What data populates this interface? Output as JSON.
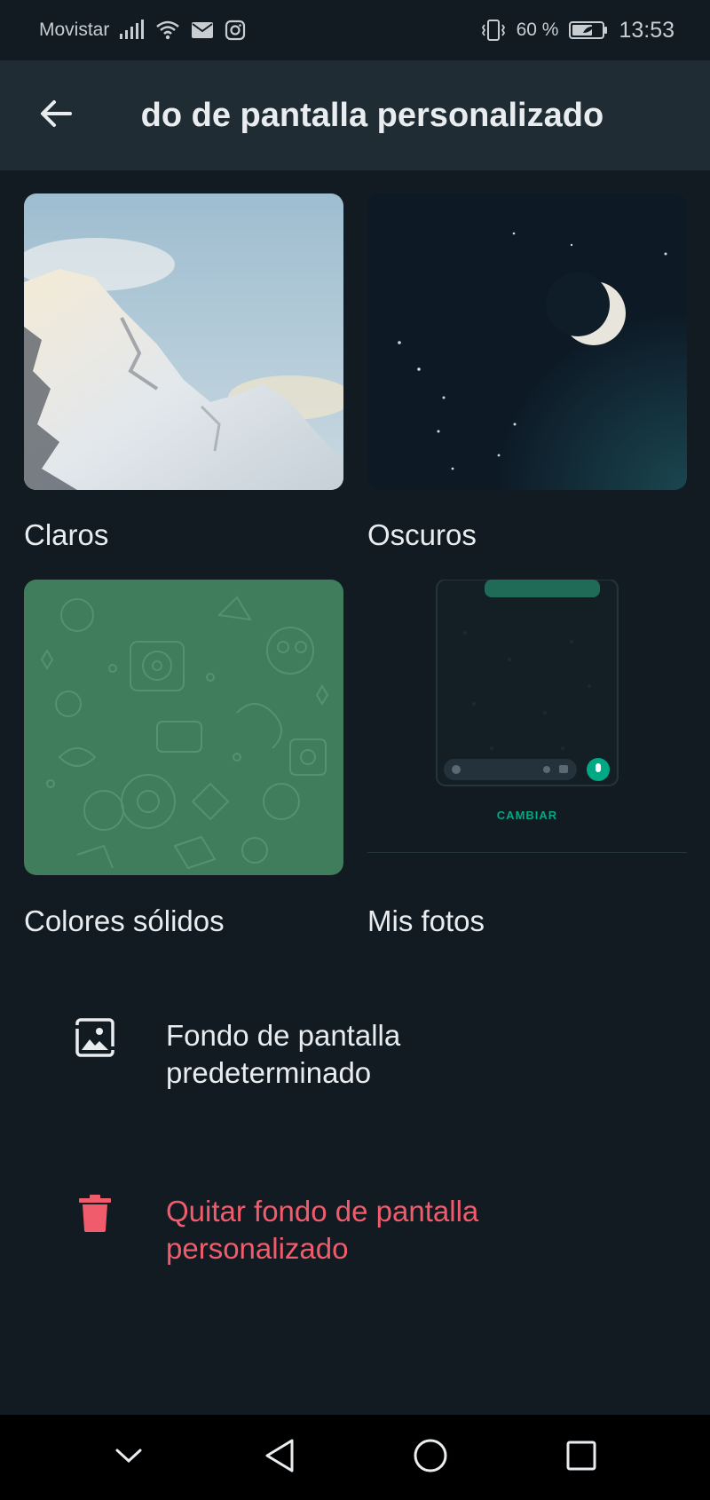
{
  "status_bar": {
    "carrier": "Movistar",
    "battery": "60 %",
    "time": "13:53"
  },
  "app_bar": {
    "title": "Fondo de pantalla personalizado",
    "back_icon": "arrow-left-icon"
  },
  "categories": [
    {
      "label": "Claros",
      "kind": "light"
    },
    {
      "label": "Oscuros",
      "kind": "dark"
    },
    {
      "label": "Colores sólidos",
      "kind": "solid"
    },
    {
      "label": "Mis fotos",
      "kind": "photos",
      "action": "CAMBIAR"
    }
  ],
  "list": {
    "default_wallpaper": "Fondo de pantalla predeterminado",
    "remove_wallpaper": "Quitar fondo de pantalla personalizado"
  },
  "colors": {
    "background": "#121b22",
    "app_bar": "#202c33",
    "accent": "#00a884",
    "danger": "#f15c6d",
    "solid_green": "#3f7d5c"
  },
  "nav": {
    "icons": [
      "chevron-down-icon",
      "back-triangle-icon",
      "home-circle-icon",
      "recents-square-icon"
    ]
  }
}
